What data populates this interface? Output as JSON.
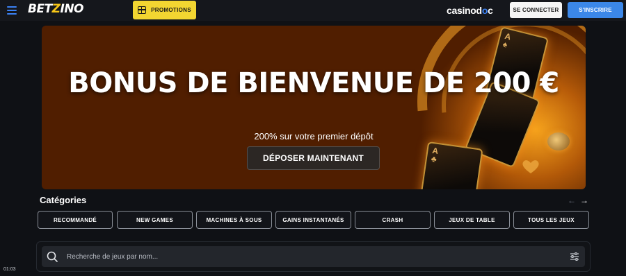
{
  "header": {
    "logo_prefix": "BET",
    "logo_z": "Z",
    "logo_suffix": "INO",
    "promotions_label": "PROMOTIONS",
    "partner_prefix": "casinod",
    "partner_accent": "o",
    "partner_suffix": "c",
    "login_label": "SE CONNECTER",
    "signup_label": "S'INSCRIRE",
    "icons": {
      "menu": "hamburger-menu-icon",
      "promotions": "gift-icon"
    },
    "colors": {
      "accent": "#3b87e8",
      "promo": "#f3d631"
    }
  },
  "hero": {
    "title": "BONUS DE BIENVENUE DE 200 €",
    "subtitle": "200% sur votre premier dépôt",
    "cta_label": "DÉPOSER MAINTENANT"
  },
  "categories": {
    "title": "Catégories",
    "prev_icon": "←",
    "next_icon": "→",
    "items": [
      {
        "label": "RECOMMANDÉ"
      },
      {
        "label": "NEW GAMES"
      },
      {
        "label": "MACHINES À SOUS"
      },
      {
        "label": "GAINS INSTANTANÉS"
      },
      {
        "label": "CRASH"
      },
      {
        "label": "JEUX DE TABLE"
      },
      {
        "label": "TOUS LES JEUX"
      }
    ]
  },
  "search": {
    "placeholder": "Recherche de jeux par nom...",
    "value": "",
    "icons": {
      "search": "search-icon",
      "filter": "filter-sliders-icon"
    }
  },
  "status": {
    "clock": "01:03"
  }
}
